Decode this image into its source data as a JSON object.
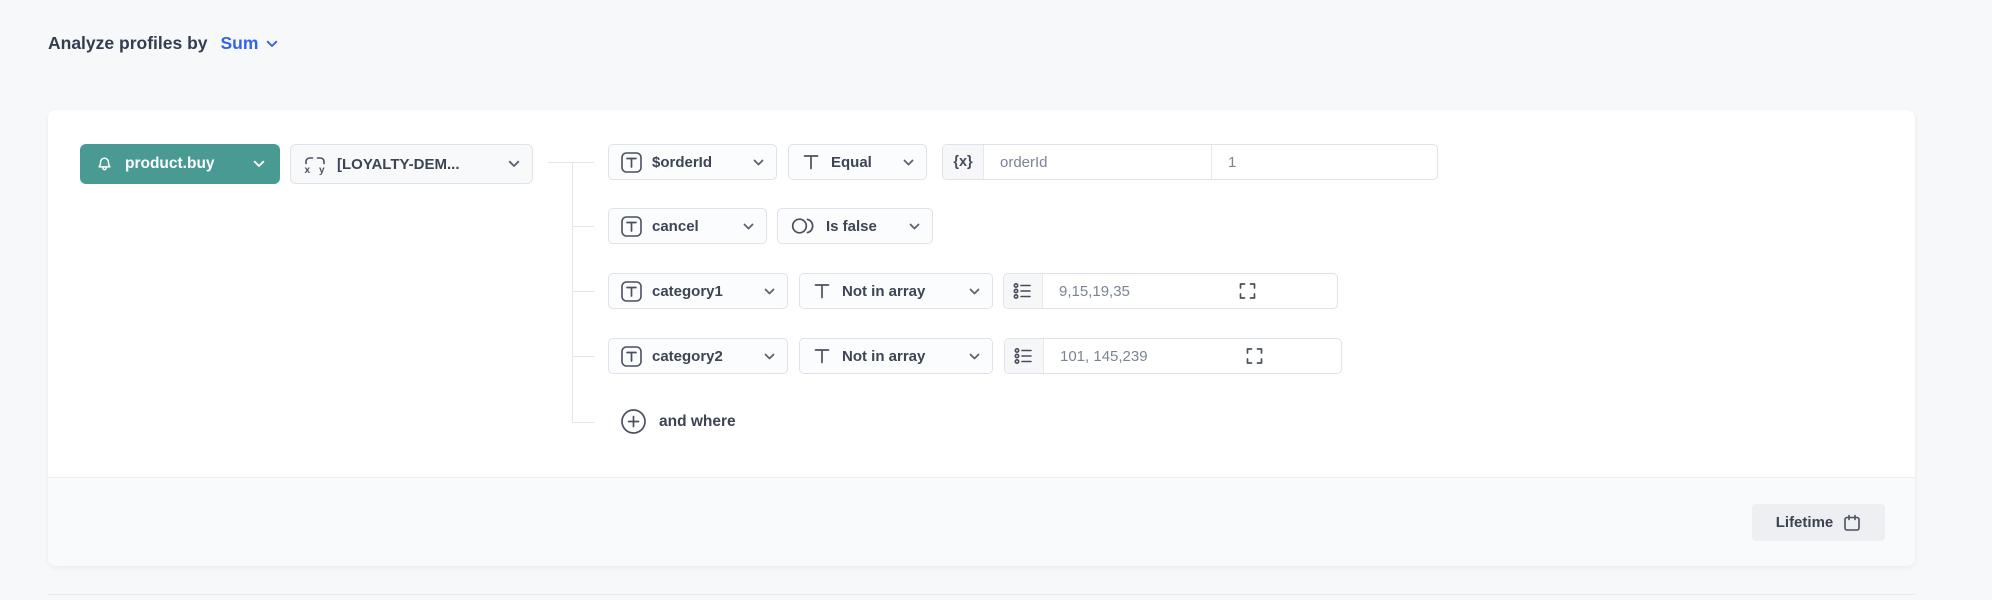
{
  "header": {
    "label": "Analyze profiles by",
    "aggregate": "Sum"
  },
  "builder": {
    "event_label": "product.buy",
    "segment_label": "[LOYALTY-DEM...",
    "expression_glyph": "{x}",
    "rows": [
      {
        "param": "$orderId",
        "operator": "Equal",
        "value_param": "orderId",
        "value": "1"
      },
      {
        "param": "cancel",
        "operator": "Is false"
      },
      {
        "param": "category1",
        "operator": "Not in array",
        "value": "9,15,19,35"
      },
      {
        "param": "category2",
        "operator": "Not in array",
        "value": "101, 145,239"
      }
    ],
    "add_label": "and where"
  },
  "footer": {
    "range_label": "Lifetime"
  },
  "icons": {
    "event": "bell-icon",
    "segment": "expression-xy-icon",
    "param_type": "text-type-boxed-icon",
    "operator_text": "text-type-icon",
    "operator_boolean": "boolean-circles-icon",
    "value_expression": "curly-x-icon",
    "value_array": "list-icon",
    "value_expand": "expand-icon",
    "add": "plus-circle-icon",
    "range": "calendar-icon",
    "dropdown": "chevron-down-icon"
  },
  "colors": {
    "accent_teal": "#4a9a94",
    "accent_blue": "#2f63ee",
    "page_bg": "#f7f8fa",
    "card_bg": "#ffffff",
    "footer_bg": "#f9fafb",
    "border": "#dfe2e8",
    "label_text": "#3d4454",
    "value_text": "#7b8494"
  }
}
